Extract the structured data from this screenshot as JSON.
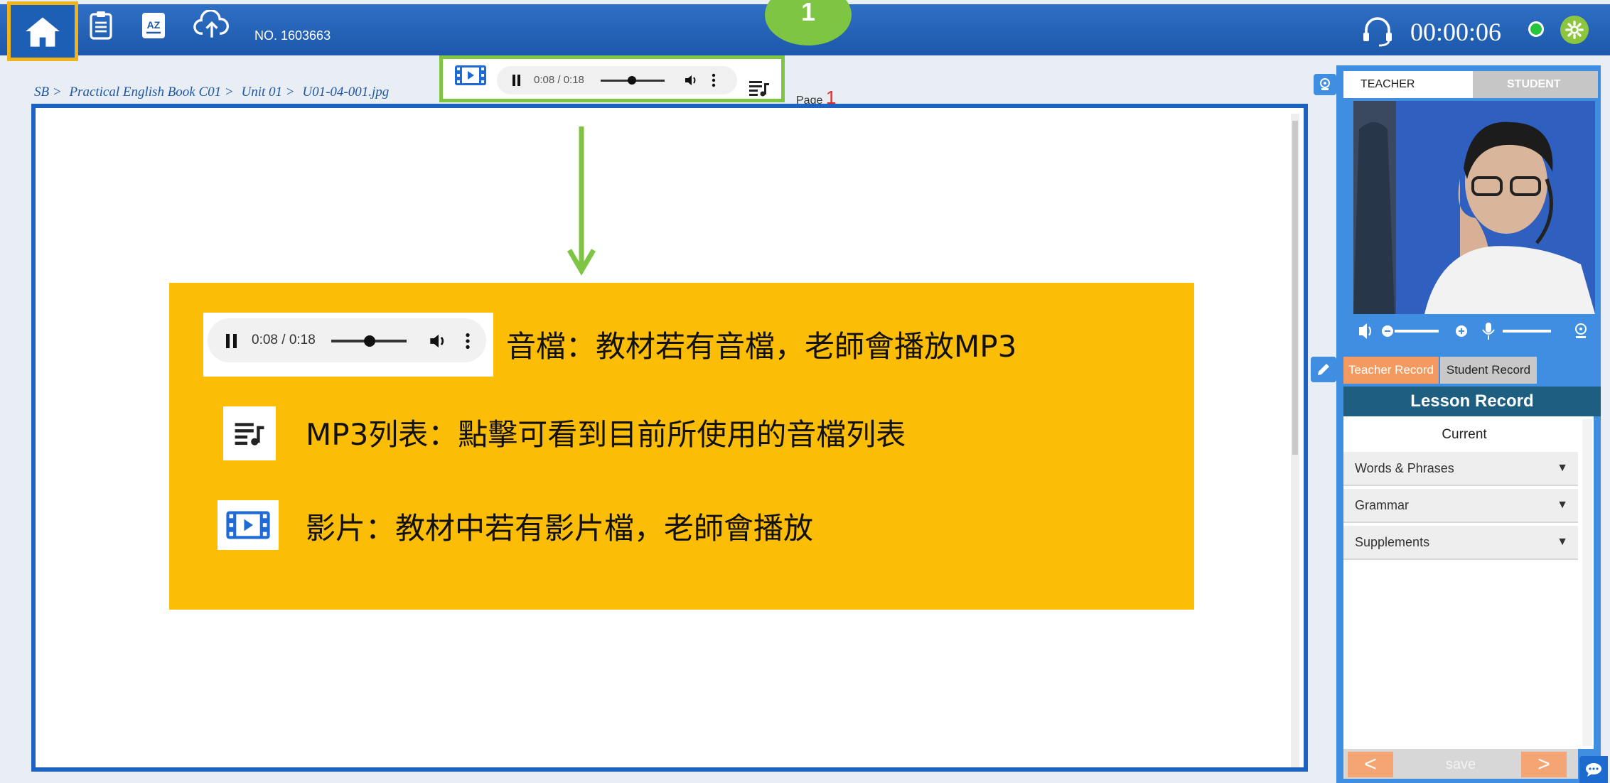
{
  "topbar": {
    "class_no": "NO. 1603663",
    "step_number": "1",
    "timer": "00:00:06",
    "status_color": "#25c53e",
    "accent_color": "#1c58ab",
    "icons": [
      "home-icon",
      "notes-icon",
      "dictionary-icon",
      "cloud-upload-icon",
      "headset-icon",
      "settings-icon"
    ]
  },
  "breadcrumb": [
    "SB >",
    "Practical English Book C01 >",
    "Unit 01 >",
    "U01-04-001.jpg"
  ],
  "media_bar": {
    "mini_time": "0:08 / 0:18",
    "page_label": "Page",
    "page_number": "1"
  },
  "info_box": {
    "player_time": "0:08 / 0:18",
    "audio_text": "音檔：教材若有音檔，老師會播放MP3",
    "playlist_text": "MP3列表：點擊可看到目前所使用的音檔列表",
    "video_text": "影片：教材中若有影片檔，老師會播放",
    "color": "#fbbd06"
  },
  "video_panel": {
    "tab_teacher": "TEACHER",
    "tab_student": "STUDENT"
  },
  "record_panel": {
    "tab_teacher": "Teacher Record",
    "tab_student": "Student Record",
    "title": "Lesson Record",
    "current": "Current",
    "items": [
      {
        "label": "Words & Phrases"
      },
      {
        "label": "Grammar"
      },
      {
        "label": "Supplements"
      }
    ],
    "save_label": "save",
    "prev_label": "<",
    "next_label": ">"
  }
}
